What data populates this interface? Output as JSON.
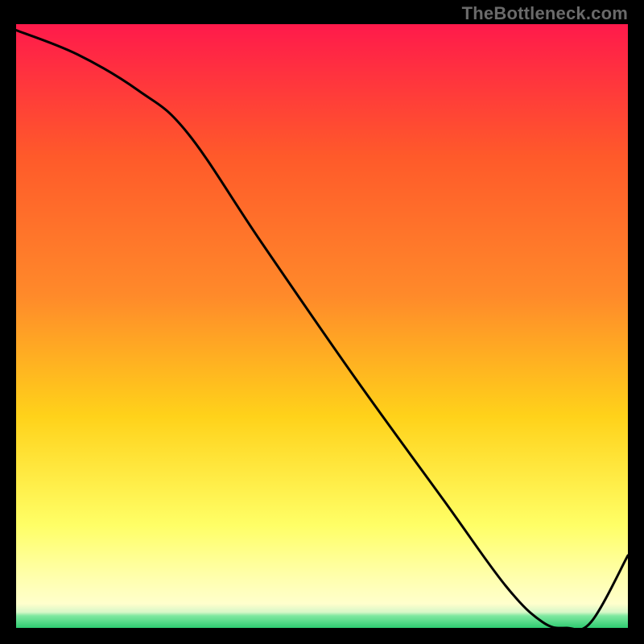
{
  "watermark": "TheBottleneck.com",
  "band_label": "",
  "chart_data": {
    "type": "line",
    "title": "",
    "xlabel": "",
    "ylabel": "",
    "xlim": [
      0,
      100
    ],
    "ylim": [
      0,
      100
    ],
    "grid": false,
    "legend": false,
    "background_gradient": {
      "top": "#ff1a4b",
      "mid_upper": "#ff8a2a",
      "mid": "#ffd21a",
      "lower": "#ffff66",
      "pale": "#ffffcc",
      "bottom": "#2ecc71"
    },
    "x": [
      0,
      10,
      20,
      28,
      40,
      55,
      70,
      80,
      86,
      90,
      94,
      100
    ],
    "values": [
      99,
      95,
      89,
      82,
      64,
      42,
      21,
      7,
      1,
      0,
      1,
      12
    ],
    "minimum_band": {
      "x_start": 84,
      "x_end": 93,
      "y": 0
    },
    "notes": "Curve descends from top-left, slight knee around x≈28, reaches y≈0 near x≈88–92, then rises toward bottom-right corner. Green strip occupies roughly the bottom 2% of the plot height; pale-yellow band sits just above it."
  }
}
